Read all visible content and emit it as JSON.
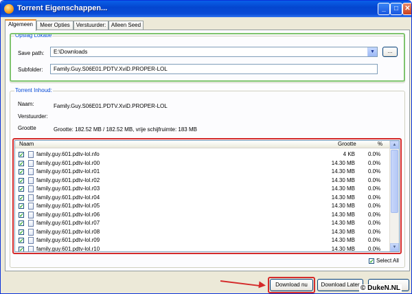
{
  "window": {
    "title": "Torrent Eigenschappen...",
    "min": "_",
    "max": "□",
    "close": "✕"
  },
  "tabs": [
    {
      "label": "Algemeen",
      "active": true
    },
    {
      "label": "Meer Opties",
      "active": false
    },
    {
      "label": "Verstuurder:",
      "active": false
    },
    {
      "label": "Alleen Seed",
      "active": false
    }
  ],
  "location": {
    "legend": "Opslag Lokatie",
    "save_path_label": "Save path:",
    "save_path_value": "E:\\Downloads",
    "browse_label": "...",
    "subfolder_label": "Subfolder:",
    "subfolder_value": "Family.Guy.S06E01.PDTV.XviD.PROPER-LOL"
  },
  "content": {
    "legend": "Torrent Inhoud:",
    "name_label": "Naam:",
    "name_value": "Family.Guy.S06E01.PDTV.XviD.PROPER-LOL",
    "sender_label": "Verstuurder:",
    "sender_value": "",
    "size_label": "Grootte",
    "size_value": "Grootte: 182.52 MB / 182.52 MB, vrije schijfruimte: 183 MB"
  },
  "files": {
    "columns": {
      "name": "Naam",
      "size": "Grootte",
      "pct": "%"
    },
    "rows": [
      {
        "name": "family.guy.601.pdtv-lol.nfo",
        "size": "4 KB",
        "pct": "0.0%",
        "checked": true
      },
      {
        "name": "family.guy.601.pdtv-lol.r00",
        "size": "14.30 MB",
        "pct": "0.0%",
        "checked": true
      },
      {
        "name": "family.guy.601.pdtv-lol.r01",
        "size": "14.30 MB",
        "pct": "0.0%",
        "checked": true
      },
      {
        "name": "family.guy.601.pdtv-lol.r02",
        "size": "14.30 MB",
        "pct": "0.0%",
        "checked": true
      },
      {
        "name": "family.guy.601.pdtv-lol.r03",
        "size": "14.30 MB",
        "pct": "0.0%",
        "checked": true
      },
      {
        "name": "family.guy.601.pdtv-lol.r04",
        "size": "14.30 MB",
        "pct": "0.0%",
        "checked": true
      },
      {
        "name": "family.guy.601.pdtv-lol.r05",
        "size": "14.30 MB",
        "pct": "0.0%",
        "checked": true
      },
      {
        "name": "family.guy.601.pdtv-lol.r06",
        "size": "14.30 MB",
        "pct": "0.0%",
        "checked": true
      },
      {
        "name": "family.guy.601.pdtv-lol.r07",
        "size": "14.30 MB",
        "pct": "0.0%",
        "checked": true
      },
      {
        "name": "family.guy.601.pdtv-lol.r08",
        "size": "14.30 MB",
        "pct": "0.0%",
        "checked": true
      },
      {
        "name": "family.guy.601.pdtv-lol.r09",
        "size": "14.30 MB",
        "pct": "0.0%",
        "checked": true
      },
      {
        "name": "family.guy.601.pdtv-lol.r10",
        "size": "14.30 MB",
        "pct": "0.0%",
        "checked": true
      }
    ],
    "select_all_label": "Select All",
    "select_all_checked": true
  },
  "buttons": {
    "download_now": "Download nu",
    "download_later": "Download Later"
  },
  "watermark": "© DukeN.NL",
  "colors": {
    "highlight_red": "#d42a2a",
    "highlight_green": "#7ec36d",
    "xp_blue": "#0a4bd6"
  }
}
